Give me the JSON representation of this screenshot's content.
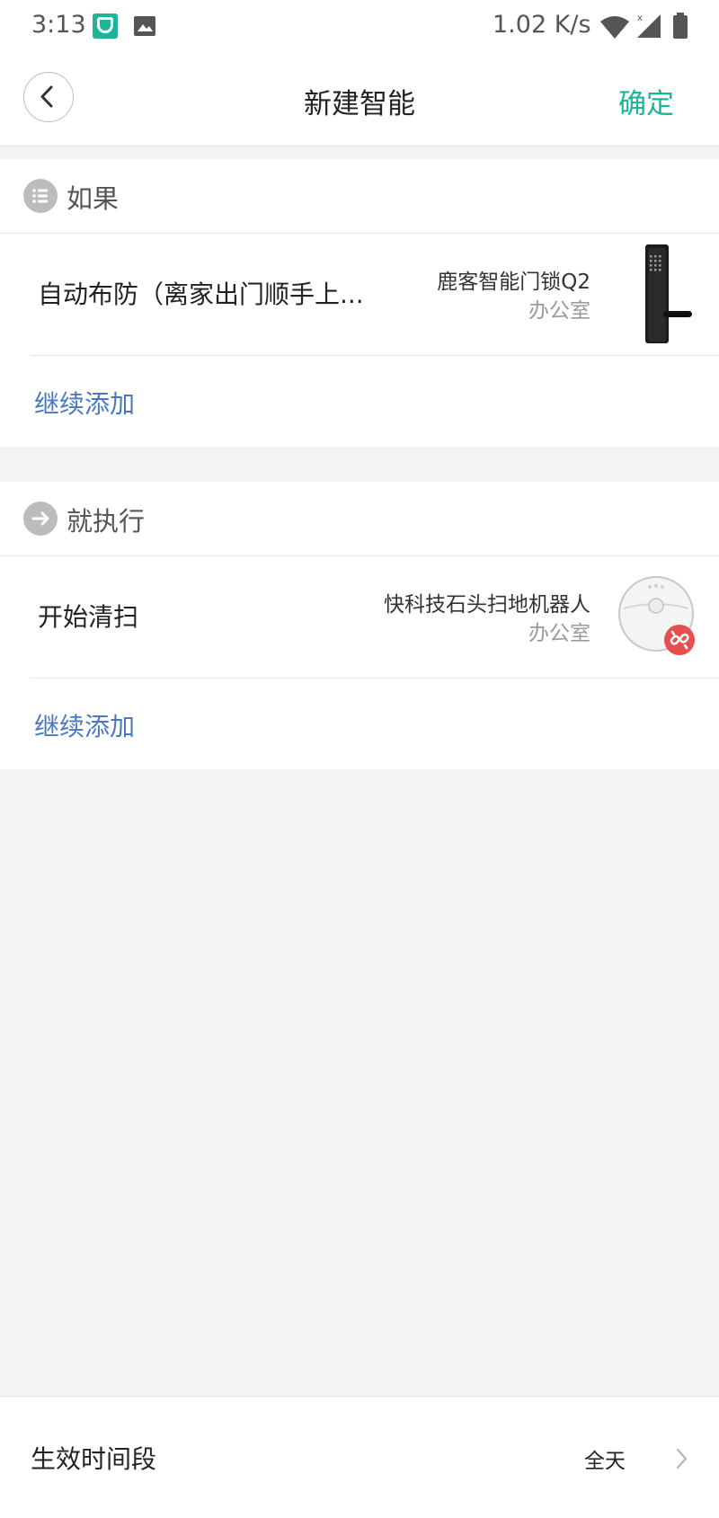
{
  "status_bar": {
    "time": "3:13",
    "network_speed": "1.02 K/s",
    "icons": [
      "mi-home-icon",
      "gallery-icon",
      "wifi-icon",
      "cellular-signal-icon",
      "battery-icon"
    ]
  },
  "header": {
    "title": "新建智能",
    "confirm_label": "确定",
    "back_icon": "chevron-left-icon"
  },
  "condition_section": {
    "title": "如果",
    "icon": "list-icon",
    "item": {
      "title": "自动布防（离家出门顺手上...",
      "device_name": "鹿客智能门锁Q2",
      "room": "办公室",
      "device_icon": "door-lock-icon"
    },
    "add_more_label": "继续添加"
  },
  "action_section": {
    "title": "就执行",
    "icon": "arrow-right-icon",
    "item": {
      "title": "开始清扫",
      "device_name": "快科技石头扫地机器人",
      "room": "办公室",
      "device_icon": "robot-vacuum-icon",
      "badge_icon": "link-broken-icon"
    },
    "add_more_label": "继续添加"
  },
  "footer": {
    "label": "生效时间段",
    "value": "全天"
  },
  "colors": {
    "accent": "#1bb59a",
    "link": "#4a78bf",
    "badge": "#e94e4e",
    "background": "#f4f4f4"
  }
}
